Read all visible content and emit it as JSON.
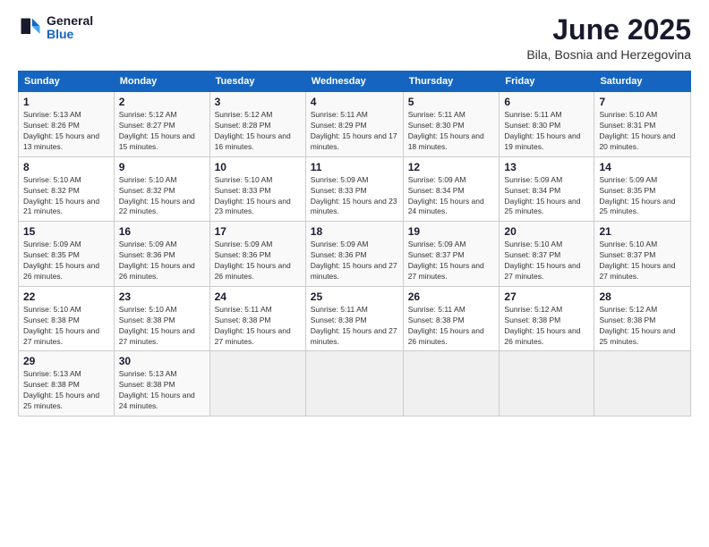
{
  "logo": {
    "general": "General",
    "blue": "Blue"
  },
  "title": "June 2025",
  "subtitle": "Bila, Bosnia and Herzegovina",
  "headers": [
    "Sunday",
    "Monday",
    "Tuesday",
    "Wednesday",
    "Thursday",
    "Friday",
    "Saturday"
  ],
  "weeks": [
    [
      {
        "day": "1",
        "sunrise": "5:13 AM",
        "sunset": "8:26 PM",
        "daylight": "15 hours and 13 minutes."
      },
      {
        "day": "2",
        "sunrise": "5:12 AM",
        "sunset": "8:27 PM",
        "daylight": "15 hours and 15 minutes."
      },
      {
        "day": "3",
        "sunrise": "5:12 AM",
        "sunset": "8:28 PM",
        "daylight": "15 hours and 16 minutes."
      },
      {
        "day": "4",
        "sunrise": "5:11 AM",
        "sunset": "8:29 PM",
        "daylight": "15 hours and 17 minutes."
      },
      {
        "day": "5",
        "sunrise": "5:11 AM",
        "sunset": "8:30 PM",
        "daylight": "15 hours and 18 minutes."
      },
      {
        "day": "6",
        "sunrise": "5:11 AM",
        "sunset": "8:30 PM",
        "daylight": "15 hours and 19 minutes."
      },
      {
        "day": "7",
        "sunrise": "5:10 AM",
        "sunset": "8:31 PM",
        "daylight": "15 hours and 20 minutes."
      }
    ],
    [
      {
        "day": "8",
        "sunrise": "5:10 AM",
        "sunset": "8:32 PM",
        "daylight": "15 hours and 21 minutes."
      },
      {
        "day": "9",
        "sunrise": "5:10 AM",
        "sunset": "8:32 PM",
        "daylight": "15 hours and 22 minutes."
      },
      {
        "day": "10",
        "sunrise": "5:10 AM",
        "sunset": "8:33 PM",
        "daylight": "15 hours and 23 minutes."
      },
      {
        "day": "11",
        "sunrise": "5:09 AM",
        "sunset": "8:33 PM",
        "daylight": "15 hours and 23 minutes."
      },
      {
        "day": "12",
        "sunrise": "5:09 AM",
        "sunset": "8:34 PM",
        "daylight": "15 hours and 24 minutes."
      },
      {
        "day": "13",
        "sunrise": "5:09 AM",
        "sunset": "8:34 PM",
        "daylight": "15 hours and 25 minutes."
      },
      {
        "day": "14",
        "sunrise": "5:09 AM",
        "sunset": "8:35 PM",
        "daylight": "15 hours and 25 minutes."
      }
    ],
    [
      {
        "day": "15",
        "sunrise": "5:09 AM",
        "sunset": "8:35 PM",
        "daylight": "15 hours and 26 minutes."
      },
      {
        "day": "16",
        "sunrise": "5:09 AM",
        "sunset": "8:36 PM",
        "daylight": "15 hours and 26 minutes."
      },
      {
        "day": "17",
        "sunrise": "5:09 AM",
        "sunset": "8:36 PM",
        "daylight": "15 hours and 26 minutes."
      },
      {
        "day": "18",
        "sunrise": "5:09 AM",
        "sunset": "8:36 PM",
        "daylight": "15 hours and 27 minutes."
      },
      {
        "day": "19",
        "sunrise": "5:09 AM",
        "sunset": "8:37 PM",
        "daylight": "15 hours and 27 minutes."
      },
      {
        "day": "20",
        "sunrise": "5:10 AM",
        "sunset": "8:37 PM",
        "daylight": "15 hours and 27 minutes."
      },
      {
        "day": "21",
        "sunrise": "5:10 AM",
        "sunset": "8:37 PM",
        "daylight": "15 hours and 27 minutes."
      }
    ],
    [
      {
        "day": "22",
        "sunrise": "5:10 AM",
        "sunset": "8:38 PM",
        "daylight": "15 hours and 27 minutes."
      },
      {
        "day": "23",
        "sunrise": "5:10 AM",
        "sunset": "8:38 PM",
        "daylight": "15 hours and 27 minutes."
      },
      {
        "day": "24",
        "sunrise": "5:11 AM",
        "sunset": "8:38 PM",
        "daylight": "15 hours and 27 minutes."
      },
      {
        "day": "25",
        "sunrise": "5:11 AM",
        "sunset": "8:38 PM",
        "daylight": "15 hours and 27 minutes."
      },
      {
        "day": "26",
        "sunrise": "5:11 AM",
        "sunset": "8:38 PM",
        "daylight": "15 hours and 26 minutes."
      },
      {
        "day": "27",
        "sunrise": "5:12 AM",
        "sunset": "8:38 PM",
        "daylight": "15 hours and 26 minutes."
      },
      {
        "day": "28",
        "sunrise": "5:12 AM",
        "sunset": "8:38 PM",
        "daylight": "15 hours and 25 minutes."
      }
    ],
    [
      {
        "day": "29",
        "sunrise": "5:13 AM",
        "sunset": "8:38 PM",
        "daylight": "15 hours and 25 minutes."
      },
      {
        "day": "30",
        "sunrise": "5:13 AM",
        "sunset": "8:38 PM",
        "daylight": "15 hours and 24 minutes."
      },
      null,
      null,
      null,
      null,
      null
    ]
  ],
  "labels": {
    "sunrise": "Sunrise:",
    "sunset": "Sunset:",
    "daylight": "Daylight:"
  }
}
